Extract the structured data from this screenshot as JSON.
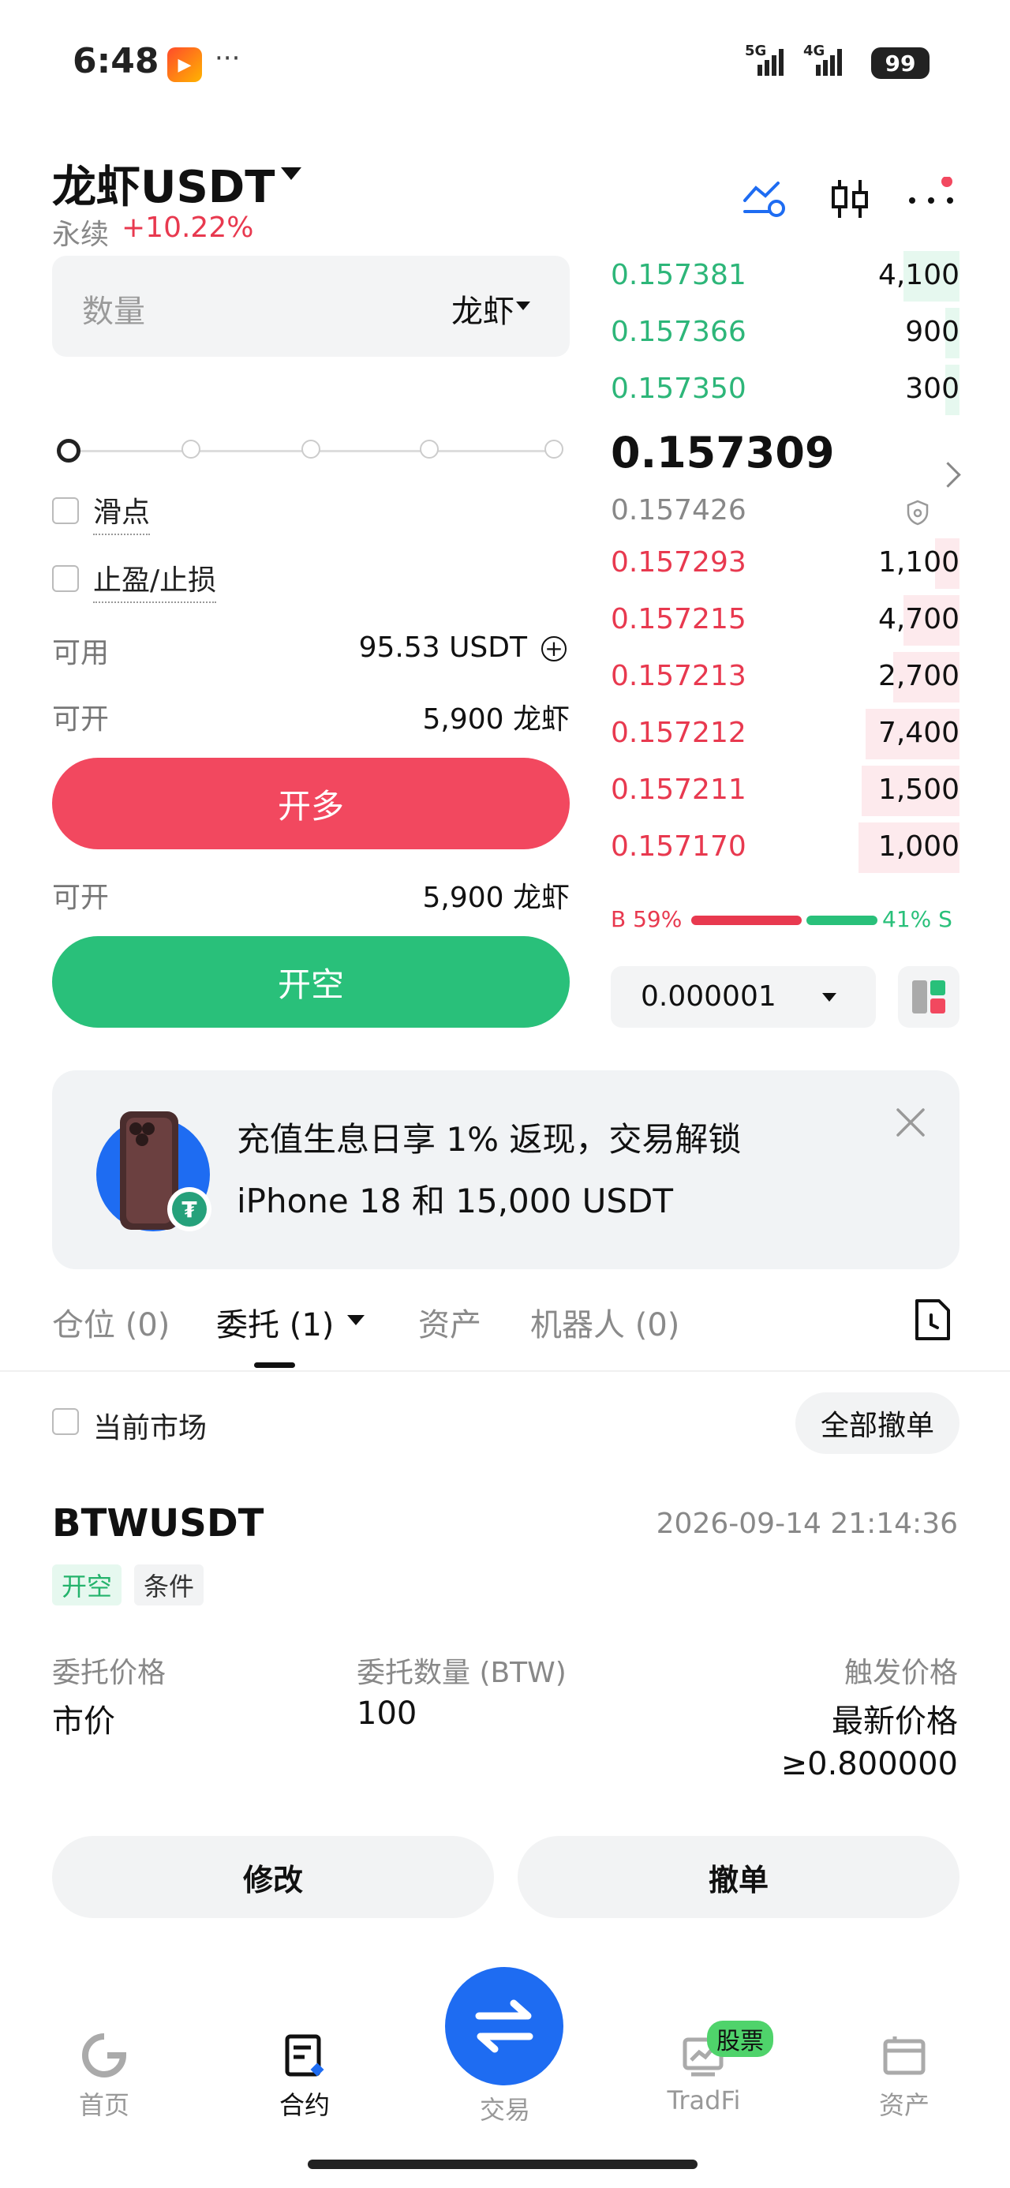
{
  "status_bar": {
    "time": "6:48",
    "more": "···",
    "signal": "5G 4G",
    "battery": "99"
  },
  "header": {
    "pair": "龙虾USDT",
    "type": "永续",
    "change": "+10.22%"
  },
  "order_form": {
    "quantity_placeholder": "数量",
    "quantity_unit": "龙虾",
    "slippage_label": "滑点",
    "tpsl_label": "止盈/止损",
    "available_label": "可用",
    "available_value": "95.53 USDT",
    "can_open_label": "可开",
    "can_open_long_value": "5,900 龙虾",
    "long_button": "开多",
    "can_open_short_value": "5,900 龙虾",
    "short_button": "开空"
  },
  "orderbook": {
    "asks": [
      {
        "price": "0.157381",
        "size": "4,100",
        "depth": 0.16
      },
      {
        "price": "0.157366",
        "size": "900",
        "depth": 0.04
      },
      {
        "price": "0.157350",
        "size": "300",
        "depth": 0.04
      }
    ],
    "last_price": "0.157309",
    "mark_price": "0.157426",
    "bids": [
      {
        "price": "0.157293",
        "size": "1,100",
        "depth": 0.07
      },
      {
        "price": "0.157215",
        "size": "4,700",
        "depth": 0.16
      },
      {
        "price": "0.157213",
        "size": "2,700",
        "depth": 0.19
      },
      {
        "price": "0.157212",
        "size": "7,400",
        "depth": 0.27
      },
      {
        "price": "0.157211",
        "size": "1,500",
        "depth": 0.28
      },
      {
        "price": "0.157170",
        "size": "1,000",
        "depth": 0.29
      }
    ],
    "buy_ratio": "B 59%",
    "sell_ratio": "41% S",
    "precision": "0.000001"
  },
  "banner": {
    "line1": "充值生息日享 1% 返现，交易解锁",
    "line2": "iPhone 18 和 15,000 USDT"
  },
  "tabs": {
    "positions": "仓位 (0)",
    "orders": "委托 (1)",
    "assets": "资产",
    "bots": "机器人 (0)"
  },
  "orders_panel": {
    "current_market": "当前市场",
    "cancel_all": "全部撤单",
    "order": {
      "symbol": "BTWUSDT",
      "time": "2026-09-14 21:14:36",
      "tag_side": "开空",
      "tag_type": "条件",
      "price_label": "委托价格",
      "price_value": "市价",
      "qty_label": "委托数量 (BTW)",
      "qty_value": "100",
      "trigger_label": "触发价格",
      "trigger_value": "最新价格",
      "trigger_cond": "≥0.800000",
      "modify": "修改",
      "cancel": "撤单"
    }
  },
  "bottom_nav": {
    "home": "首页",
    "futures": "合约",
    "trade": "交易",
    "tradfi": "TradFi",
    "stock_badge": "股票",
    "assets": "资产"
  },
  "colors": {
    "long_red": "#f2485f",
    "short_green": "#29c07a",
    "trade_blue": "#1e6cf2"
  }
}
